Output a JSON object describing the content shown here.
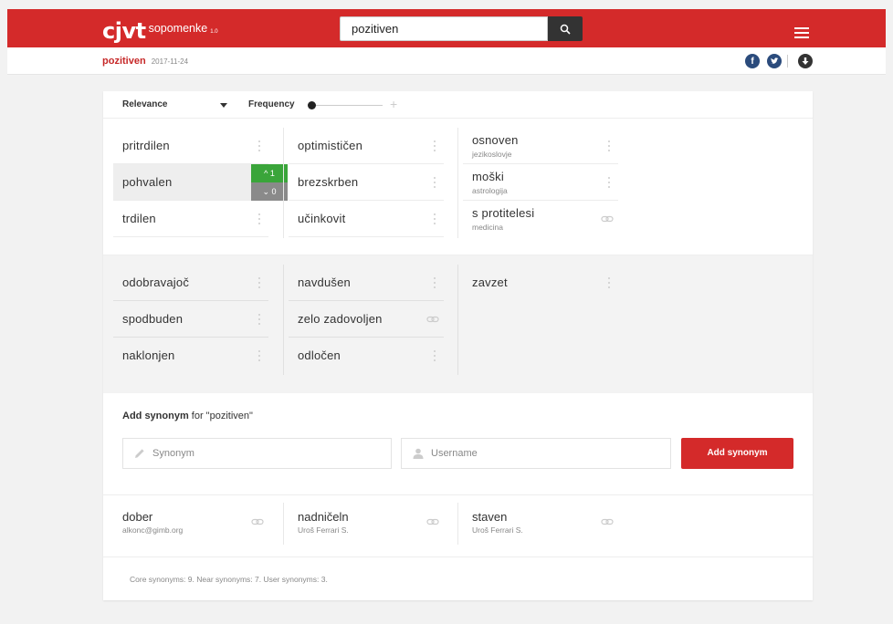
{
  "header": {
    "logo_mark": "cjvt",
    "logo_word": "sopomenke",
    "logo_version": "1.0",
    "search_value": "pozitiven",
    "icons": [
      "search-icon",
      "menu-icon"
    ],
    "accent_color": "#d42a2a"
  },
  "subheader": {
    "word": "pozitiven",
    "date": "2017-11-24",
    "icons": [
      "facebook-icon",
      "twitter-icon",
      "download-icon"
    ]
  },
  "toolbar": {
    "sort_label": "Relevance",
    "frequency_label": "Frequency"
  },
  "core_synonyms": {
    "col1": [
      {
        "label": "pritrdilen"
      },
      {
        "label": "pohvalen",
        "votes_up": "1",
        "votes_down": "0"
      },
      {
        "label": "trdilen"
      }
    ],
    "col2": [
      {
        "label": "optimističen"
      },
      {
        "label": "brezskrben"
      },
      {
        "label": "učinkovit"
      }
    ],
    "col3": [
      {
        "label": "osnoven",
        "domain": "jezikoslovje"
      },
      {
        "label": "moški",
        "domain": "astrologija"
      },
      {
        "label": "s protitelesi",
        "domain": "medicina"
      }
    ]
  },
  "near_synonyms": {
    "col1": [
      {
        "label": "odobravajoč"
      },
      {
        "label": "spodbuden"
      },
      {
        "label": "naklonjen"
      }
    ],
    "col2": [
      {
        "label": "navdušen"
      },
      {
        "label": "zelo zadovoljen"
      },
      {
        "label": "odločen"
      }
    ],
    "col3": [
      {
        "label": "zavzet"
      }
    ]
  },
  "add_synonym": {
    "title_bold": "Add synonym",
    "title_rest": " for \"pozitiven\"",
    "synonym_placeholder": "Synonym",
    "username_placeholder": "Username",
    "button_label": "Add synonym"
  },
  "user_synonyms": [
    {
      "label": "dober",
      "user": "alkonc@gimb.org"
    },
    {
      "label": "nadničeln",
      "user": "Uroš Ferrari S."
    },
    {
      "label": "staven",
      "user": "Uroš Ferrari S."
    }
  ],
  "footer": {
    "summary": "Core synonyms: 9. Near synonyms: 7. User synonyms: 3."
  }
}
